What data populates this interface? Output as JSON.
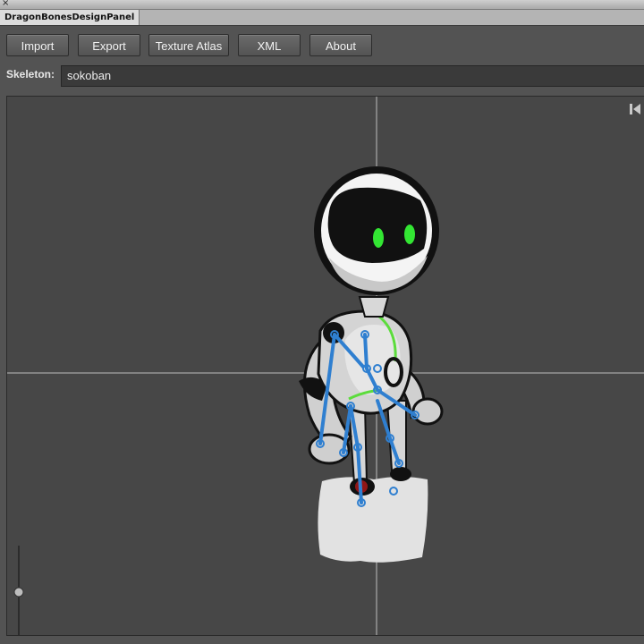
{
  "window": {
    "close_glyph": "×"
  },
  "panel": {
    "tab_title": "DragonBonesDesignPanel"
  },
  "toolbar": {
    "buttons": [
      {
        "label": "Import"
      },
      {
        "label": "Export"
      },
      {
        "label": "Texture Atlas"
      },
      {
        "label": "XML"
      },
      {
        "label": "About"
      }
    ]
  },
  "skeleton": {
    "label": "Skeleton:",
    "selected": "sokoban"
  },
  "stage": {
    "icons": [
      "skip-to-start-icon"
    ],
    "accent_colors": {
      "bone": "#2f7fd0",
      "joint_highlight": "#5cdc3c",
      "eyes": "#33e633"
    }
  }
}
